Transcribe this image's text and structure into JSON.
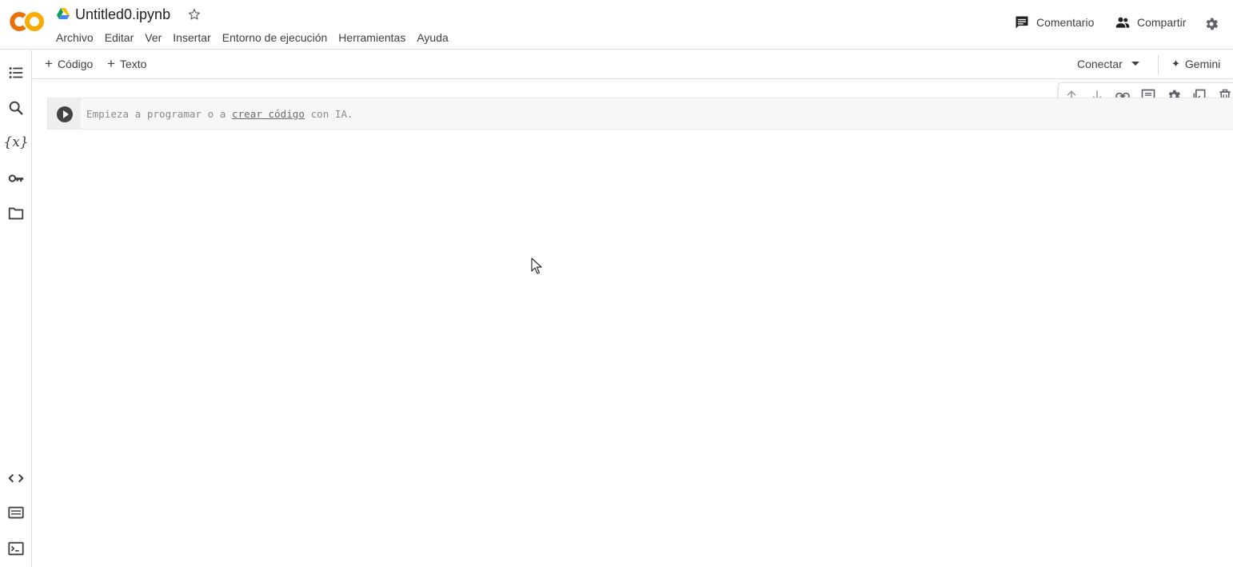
{
  "header": {
    "title": "Untitled0.ipynb",
    "menu": [
      "Archivo",
      "Editar",
      "Ver",
      "Insertar",
      "Entorno de ejecución",
      "Herramientas",
      "Ayuda"
    ],
    "comment_label": "Comentario",
    "share_label": "Compartir"
  },
  "sidebar": {
    "icons": [
      "table-of-contents-icon",
      "search-icon",
      "variables-icon",
      "secrets-key-icon",
      "files-folder-icon",
      "code-snippets-icon",
      "command-palette-icon",
      "terminal-icon"
    ],
    "variables_glyph": "{x}"
  },
  "toolbar": {
    "add_code_label": "Código",
    "add_text_label": "Texto",
    "connect_label": "Conectar",
    "gemini_label": "Gemini",
    "gemini_glyph": "✦"
  },
  "cell": {
    "placeholder_before": "Empieza a programar o a ",
    "placeholder_link": "crear código",
    "placeholder_after": " con IA."
  },
  "cell_toolbar": {
    "icons": [
      "move-up-icon",
      "move-down-icon",
      "link-icon",
      "comment-icon",
      "settings-icon",
      "mirror-cell-icon",
      "delete-icon"
    ]
  },
  "colors": {
    "logo_orange": "#F9AB00",
    "logo_dark_orange": "#E8710A",
    "text": "#202124",
    "border": "#dadce0",
    "cell_bg": "#f7f7f7"
  }
}
